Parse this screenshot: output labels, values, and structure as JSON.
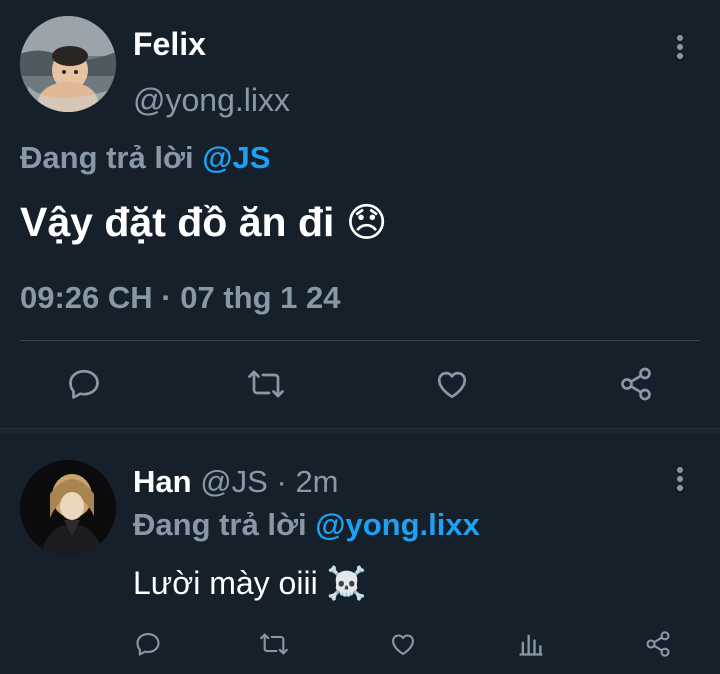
{
  "main_tweet": {
    "author_name": "Felix",
    "author_handle": "@yong.lixx",
    "reply_prefix": "Đang trả lời",
    "reply_to": "@JS",
    "text": "Vậy đặt đồ ăn đi",
    "emoji": "😞",
    "timestamp": "09:26 CH · 07 thg 1 24"
  },
  "reply_tweet": {
    "author_name": "Han",
    "author_handle": "@JS",
    "time_sep": "·",
    "time_ago": "2m",
    "reply_prefix": "Đang trả lời",
    "reply_to": "@yong.lixx",
    "text": "Lười mày oiii",
    "emoji": "☠️"
  },
  "colors": {
    "background": "#15202b",
    "muted": "#8899a6",
    "accent": "#1da1f2",
    "divider": "#38444d"
  },
  "icons": {
    "main_actions": [
      "reply-icon",
      "retweet-icon",
      "like-icon",
      "share-icon"
    ],
    "reply_actions": [
      "reply-icon",
      "retweet-icon",
      "like-icon",
      "analytics-icon",
      "share-icon"
    ],
    "more": "more-vertical-icon"
  }
}
